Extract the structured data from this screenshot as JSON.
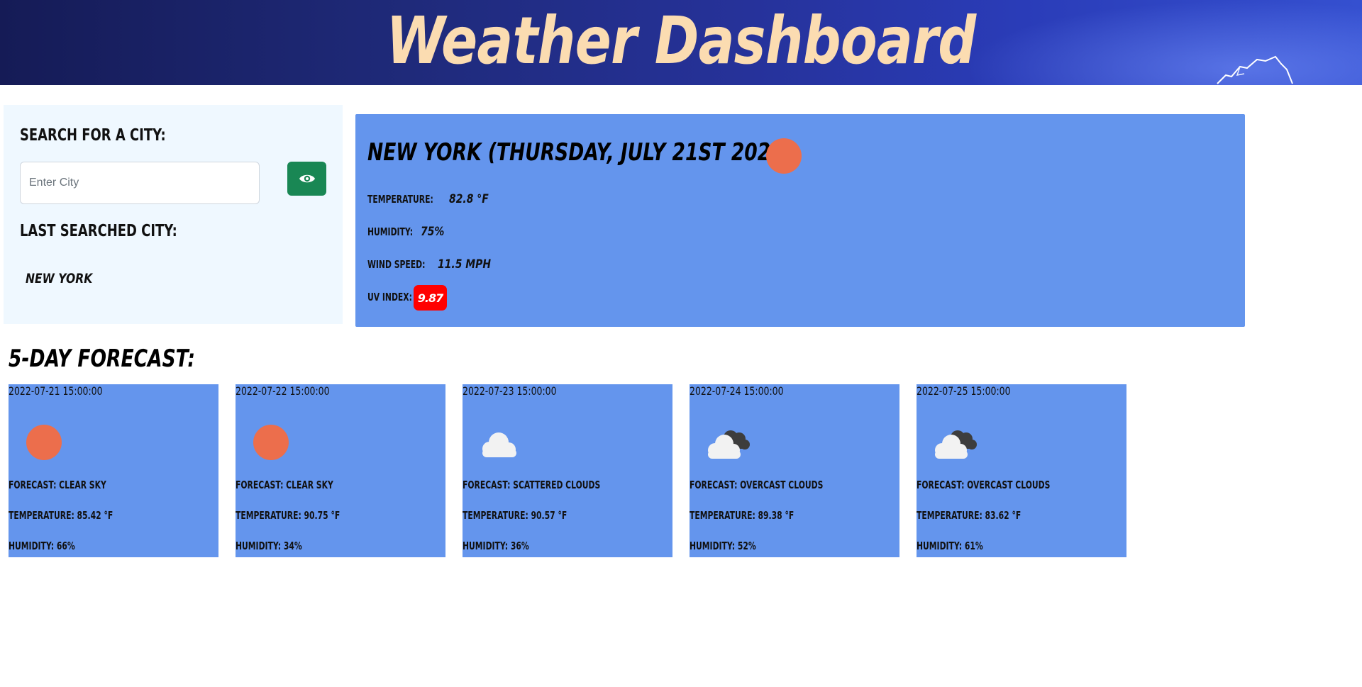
{
  "header": {
    "title": "Weather Dashboard"
  },
  "search": {
    "title": "Search for a City:",
    "placeholder": "Enter City",
    "value": "",
    "button_icon": "eye-icon",
    "last_title": "Last Searched City:",
    "last_city": "New York"
  },
  "current": {
    "title": "New York (Thursday, July 21st 2022)",
    "icon": "clear-sky-icon",
    "temperature_label": "Temperature:",
    "temperature_value": "82.8 °F",
    "humidity_label": "Humidity:",
    "humidity_value": "75%",
    "wind_label": "Wind Speed:",
    "wind_value": "11.5 MPH",
    "uv_label": "UV Index:",
    "uv_value": "9.87"
  },
  "forecast": {
    "title": "5-Day Forecast:",
    "days": [
      {
        "date": "2022-07-21 15:00:00",
        "icon": "clear-sky-icon",
        "forecast": "Forecast: Clear sky",
        "temperature": "Temperature: 85.42 °F",
        "humidity": "Humidity: 66%"
      },
      {
        "date": "2022-07-22 15:00:00",
        "icon": "clear-sky-icon",
        "forecast": "Forecast: Clear sky",
        "temperature": "Temperature: 90.75 °F",
        "humidity": "Humidity: 34%"
      },
      {
        "date": "2022-07-23 15:00:00",
        "icon": "scattered-clouds-icon",
        "forecast": "Forecast: scattered clouds",
        "temperature": "Temperature: 90.57 °F",
        "humidity": "Humidity: 36%"
      },
      {
        "date": "2022-07-24 15:00:00",
        "icon": "overcast-clouds-icon",
        "forecast": "Forecast: overcast clouds",
        "temperature": "Temperature: 89.38 °F",
        "humidity": "Humidity: 52%"
      },
      {
        "date": "2022-07-25 15:00:00",
        "icon": "overcast-clouds-icon",
        "forecast": "Forecast: overcast clouds",
        "temperature": "Temperature: 83.62 °F",
        "humidity": "Humidity: 61%"
      }
    ]
  },
  "colors": {
    "header_bg": "#1f2a7a",
    "title_text": "#fbdcb1",
    "panel_bg": "#eff8ff",
    "card_bg": "#6495ed",
    "sun": "#ec6e4c",
    "uv_badge": "#ff0000",
    "search_button": "#198754"
  }
}
